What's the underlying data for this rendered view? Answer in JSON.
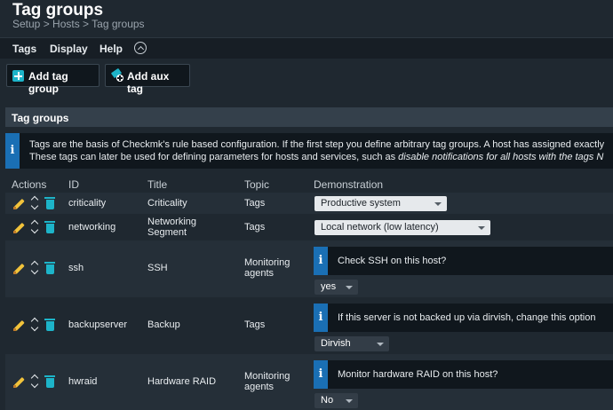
{
  "header": {
    "title": "Tag groups",
    "breadcrumb": "Setup > Hosts > Tag groups"
  },
  "menu": [
    "Tags",
    "Display",
    "Help"
  ],
  "actions": {
    "add_tag_group": "Add tag group",
    "add_aux_tag": "Add aux tag"
  },
  "section": {
    "title": "Tag groups",
    "info_line1": "Tags are the basis of Checkmk's rule based configuration. If the first step you define arbitrary tag groups. A host has assigned exactly",
    "info_line2_plain": "These tags can later be used for defining parameters for hosts and services, such as ",
    "info_line2_em": "disable notifications for all hosts with the tags N"
  },
  "table": {
    "headers": [
      "Actions",
      "ID",
      "Title",
      "Topic",
      "Demonstration"
    ],
    "rows": [
      {
        "id": "criticality",
        "title": "Criticality",
        "topic": "Tags",
        "demo_select": "Productive system"
      },
      {
        "id": "networking",
        "title": "Networking Segment",
        "topic": "Tags",
        "demo_select": "Local network (low latency)"
      },
      {
        "id": "ssh",
        "title": "SSH",
        "topic": "Monitoring agents",
        "demo_question": "Check SSH on this host?",
        "demo_select": "yes"
      },
      {
        "id": "backupserver",
        "title": "Backup",
        "topic": "Tags",
        "demo_question": "If this server is not backed up via dirvish, change this option",
        "demo_select": "Dirvish"
      },
      {
        "id": "hwraid",
        "title": "Hardware RAID",
        "topic": "Monitoring agents",
        "demo_question": "Monitor hardware RAID on this host?",
        "demo_select": "No"
      }
    ]
  },
  "icons": {
    "edit": "pencil-icon",
    "move": "up-down-icon",
    "delete": "trash-icon",
    "info": "info-icon"
  },
  "colors": {
    "background": "#1f2830",
    "accent": "#1db4c9",
    "info": "#1a6fb4",
    "edit": "#f2c33b"
  }
}
